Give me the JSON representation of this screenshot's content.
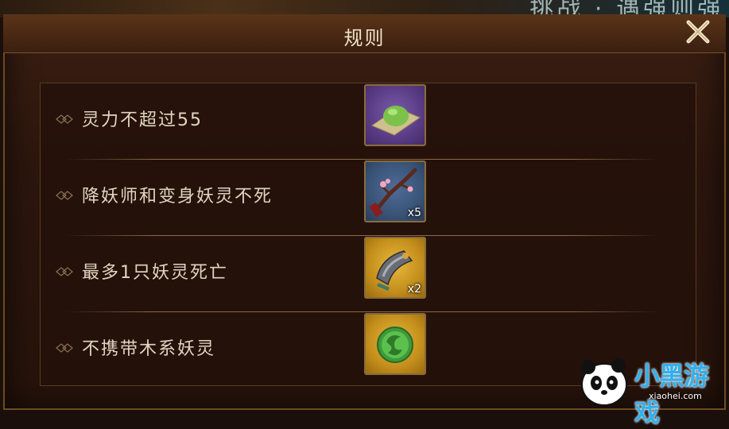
{
  "dialog": {
    "title": "规则",
    "close_icon": "close-x-icon"
  },
  "background": {
    "title_fragment": "挑战 · 遇强则强"
  },
  "rules": [
    {
      "text": "灵力不超过55",
      "item": {
        "icon": "green-dumpling-icon",
        "frame": "purple",
        "qty": ""
      }
    },
    {
      "text": "降妖师和变身妖灵不死",
      "item": {
        "icon": "plum-branch-icon",
        "frame": "blue",
        "qty": "x5"
      }
    },
    {
      "text": "最多1只妖灵死亡",
      "item": {
        "icon": "bracer-icon",
        "frame": "gold",
        "qty": "x2"
      }
    },
    {
      "text": "不携带木系妖灵",
      "item": {
        "icon": "wood-element-orb-icon",
        "frame": "gold",
        "qty": ""
      }
    }
  ],
  "watermark": {
    "brand": "小黑游戏",
    "url": "xiaohei.com"
  }
}
